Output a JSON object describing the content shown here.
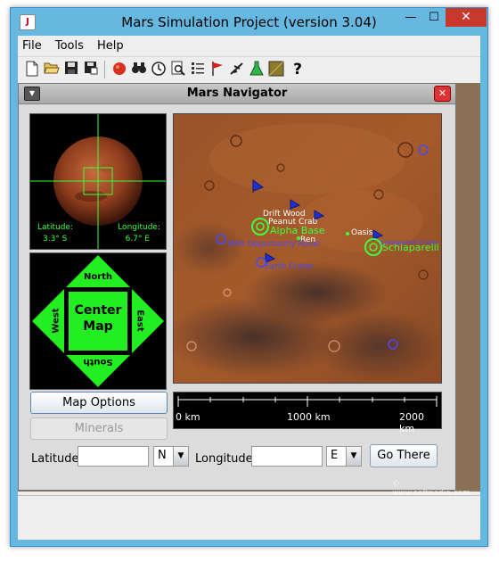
{
  "window": {
    "title": "Mars Simulation Project (version 3.04)",
    "controls": {
      "minimize": "—",
      "maximize": "☐",
      "close": "✕"
    }
  },
  "menubar": {
    "items": [
      "File",
      "Tools",
      "Help"
    ]
  },
  "toolbar": {
    "buttons": [
      "new-icon",
      "open-icon",
      "save-icon",
      "save-as-icon",
      "mars-globe-icon",
      "binoculars-icon",
      "clock-icon",
      "search-icon",
      "list-icon",
      "flag-icon",
      "plane-icon",
      "flask-icon",
      "map-icon",
      "help-icon"
    ]
  },
  "navigator": {
    "title": "Mars Navigator",
    "globe": {
      "latitude_label": "Latitude:",
      "latitude_value": "3.3° S",
      "longitude_label": "Longitude:",
      "longitude_value": "6.7° E"
    },
    "compass": {
      "north": "North",
      "south": "South",
      "east": "East",
      "west": "West",
      "center_line1": "Center",
      "center_line2": "Map"
    },
    "map_labels": {
      "drift_wood": "Drift Wood",
      "crab": "Peanut Crab",
      "alpha": "Alpha Base",
      "ren": "Ren",
      "mer": "MER Opportunity Rover",
      "crater": "Earth Crater",
      "oasis": "Oasis",
      "schiap": "Schiaparelli",
      "schiap_sub": "Schiaparelli Crater"
    },
    "scale": {
      "zero": "0 km",
      "mid": "1000 km",
      "max": "2000 km"
    },
    "buttons": {
      "map_options": "Map Options",
      "minerals": "Minerals"
    },
    "coords": {
      "latitude_label": "Latitude:",
      "lat_value": "",
      "lat_dir": "N",
      "longitude_label": "Longitude:",
      "lon_value": "",
      "lon_dir": "E",
      "go_there": "Go There"
    }
  },
  "watermark": "© www.softpedia.com"
}
